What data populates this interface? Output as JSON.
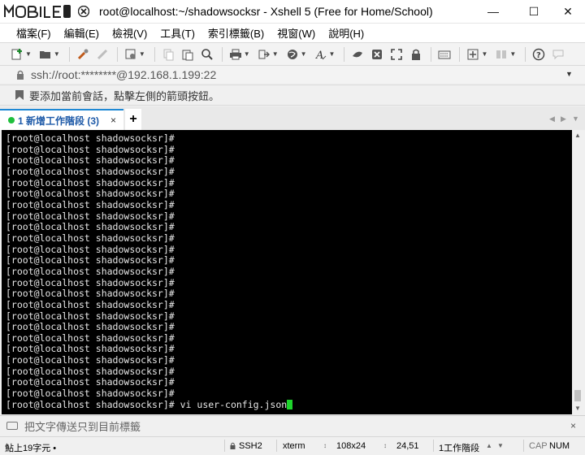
{
  "window": {
    "logo_text": "MOBILE01",
    "title": "root@localhost:~/shadowsocksr - Xshell 5 (Free for Home/School)",
    "minimize_glyph": "—",
    "maximize_glyph": "☐",
    "close_glyph": "✕"
  },
  "menu": {
    "items": [
      "檔案(F)",
      "編輯(E)",
      "檢視(V)",
      "工具(T)",
      "索引標籤(B)",
      "視窗(W)",
      "說明(H)"
    ]
  },
  "toolbar": {
    "icons": [
      "new-session-icon",
      "open-folder-icon",
      "reconnect-icon",
      "disconnect-icon",
      "properties-icon",
      "copy-icon",
      "paste-icon",
      "find-icon",
      "print-icon",
      "transfer-icon",
      "globe-icon",
      "font-icon",
      "xftp-icon",
      "xmanager-icon",
      "fullscreen-icon",
      "lock-icon",
      "keyboard-icon",
      "add-icon",
      "layout-icon",
      "help-icon",
      "chat-icon"
    ]
  },
  "address": {
    "value": "ssh://root:********@192.168.1.199:22"
  },
  "hint": {
    "text": "要添加當前會話，點擊左側的箭頭按鈕。"
  },
  "tabs": {
    "active_label": "1 新增工作階段 (3)",
    "close_glyph": "×",
    "add_glyph": "+",
    "nav_prev": "◀",
    "nav_next": "▶",
    "nav_menu": "▼"
  },
  "terminal": {
    "lines": [
      "[root@localhost shadowsocksr]#",
      "[root@localhost shadowsocksr]#",
      "[root@localhost shadowsocksr]#",
      "[root@localhost shadowsocksr]#",
      "[root@localhost shadowsocksr]#",
      "[root@localhost shadowsocksr]#",
      "[root@localhost shadowsocksr]#",
      "[root@localhost shadowsocksr]#",
      "[root@localhost shadowsocksr]#",
      "[root@localhost shadowsocksr]#",
      "[root@localhost shadowsocksr]#",
      "[root@localhost shadowsocksr]#",
      "[root@localhost shadowsocksr]#",
      "[root@localhost shadowsocksr]#",
      "[root@localhost shadowsocksr]#",
      "[root@localhost shadowsocksr]#",
      "[root@localhost shadowsocksr]#",
      "[root@localhost shadowsocksr]#",
      "[root@localhost shadowsocksr]#",
      "[root@localhost shadowsocksr]#",
      "[root@localhost shadowsocksr]#",
      "[root@localhost shadowsocksr]#",
      "[root@localhost shadowsocksr]#",
      "[root@localhost shadowsocksr]#"
    ],
    "prompt_line": "[root@localhost shadowsocksr]# vi user-config.json",
    "cursor_color": "#1ed42c",
    "background": "#000000",
    "foreground": "#e6e6e6"
  },
  "compose": {
    "placeholder": "把文字傳送只到目前標籤",
    "close_glyph": "×"
  },
  "status": {
    "left": "鮎上19字元 •",
    "protocol": "SSH2",
    "terminal_type": "xterm",
    "size": "108x24",
    "cursor_pos": "24,51",
    "sessions": "1工作階段",
    "caps": "CAP",
    "num": "NUM"
  },
  "colors": {
    "accent": "#1e88d4",
    "tab_dot": "#1fbf3c",
    "tab_label": "#1e5aa8"
  }
}
